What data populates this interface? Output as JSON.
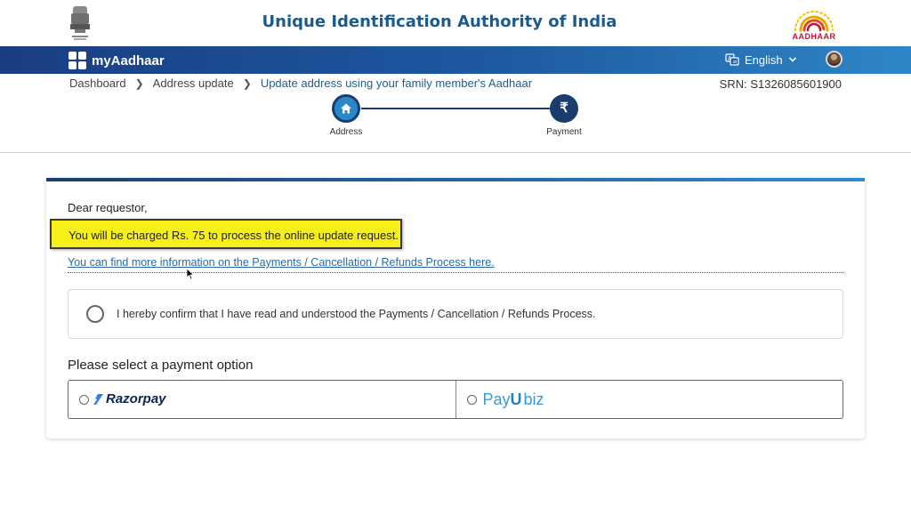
{
  "header": {
    "org_title": "Unique Identification Authority of India",
    "aadhaar_logo_text": "AADHAAR"
  },
  "navbar": {
    "brand": "myAadhaar",
    "language": "English"
  },
  "breadcrumb": {
    "items": [
      "Dashboard",
      "Address update",
      "Update address using your family member's Aadhaar"
    ],
    "srn": "SRN: S1326085601900"
  },
  "stepper": {
    "steps": [
      {
        "label": "Address",
        "icon": "home-icon"
      },
      {
        "label": "Payment",
        "icon": "rupee-icon",
        "symbol": "₹"
      }
    ]
  },
  "card": {
    "greeting": "Dear requestor,",
    "notice": "You will be charged Rs. 75 to process the online update request.",
    "info_link": "You can find more information on the Payments / Cancellation / Refunds Process here.",
    "confirm_text": "I hereby confirm that I have read and understood the Payments / Cancellation / Refunds Process.",
    "payment_title": "Please select a payment option",
    "payment_options": [
      {
        "name": "Razorpay",
        "label": "Razorpay"
      },
      {
        "name": "PayUbiz",
        "label_pay": "Pay",
        "label_u": "U",
        "label_biz": "biz"
      }
    ]
  },
  "colors": {
    "brand_blue": "#1a5b8f",
    "nav_start": "#1a3d82",
    "nav_end": "#2f86c6",
    "highlight": "#f7ef18",
    "link": "#2a6aa4"
  }
}
